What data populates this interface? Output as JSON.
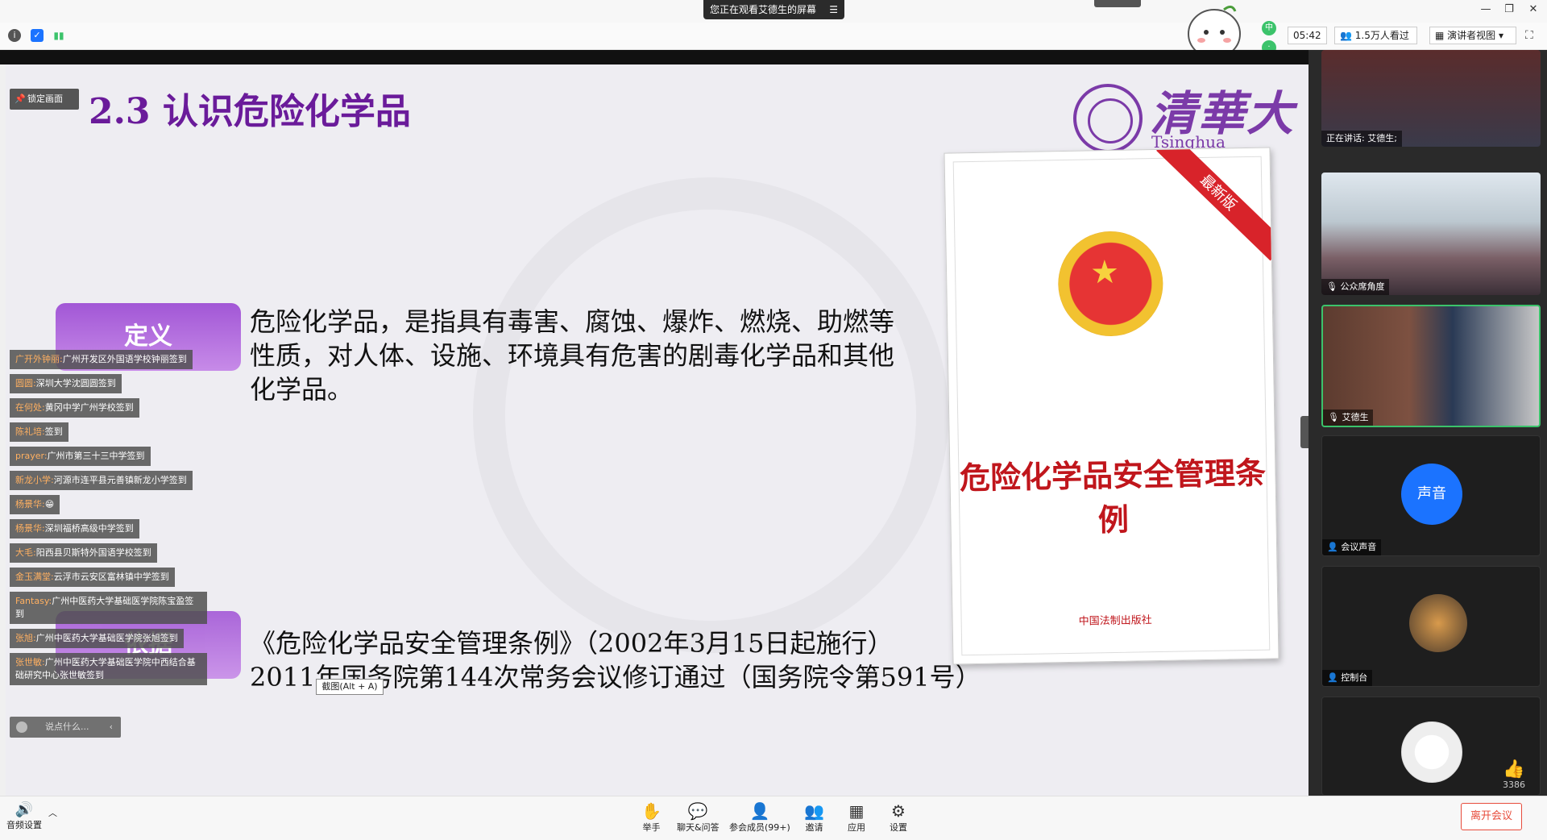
{
  "titlebar": {
    "share_notice": "您正在观看艾德生的屏幕",
    "share_menu": "☰"
  },
  "infobar": {
    "timer": "05:42",
    "viewers": "1.5万人看过",
    "view_mode": "演讲者视图",
    "mascot_dot_label": "中"
  },
  "slide": {
    "title": "2.3 认识危险化学品",
    "lock_label": "锁定画面",
    "logo_cn": "清華大學",
    "logo_en": "Tsinghua University",
    "definition_label": "定义",
    "definition_text": "危险化学品，是指具有毒害、腐蚀、爆炸、燃烧、助燃等性质，对人体、设施、环境具有危害的剧毒化学品和其他化学品。",
    "basis_label": "依据",
    "basis_line1": "《危险化学品安全管理条例》（2002年3月15日起施行）",
    "basis_line2": "2011年国务院第144次常务会议修订通过（国务院令第591号）",
    "book_ribbon": "最新版",
    "book_title": "危险化学品安全管理条例",
    "book_publisher": "中国法制出版社",
    "screenshot_tip": "截图(Alt + A)"
  },
  "chat": {
    "messages": [
      {
        "name": "广开外钟丽:",
        "text": "广州开发区外国语学校钟丽签到"
      },
      {
        "name": "圆圆:",
        "text": "深圳大学沈圆圆签到"
      },
      {
        "name": "在何处:",
        "text": "黄冈中学广州学校签到"
      },
      {
        "name": "陈礼培:",
        "text": "签到"
      },
      {
        "name": "prayer:",
        "text": "广州市第三十三中学签到"
      },
      {
        "name": "新龙小学:",
        "text": "河源市连平县元善镇新龙小学签到"
      },
      {
        "name": "杨景华:",
        "text": "😁"
      },
      {
        "name": "杨景华:",
        "text": "深圳福桥高级中学签到"
      },
      {
        "name": "大毛:",
        "text": "阳西县贝斯特外国语学校签到"
      },
      {
        "name": "金玉满堂:",
        "text": "云浮市云安区富林镇中学签到"
      },
      {
        "name": "Fantasy:",
        "text": "广州中医药大学基础医学院陈宝盈签到"
      },
      {
        "name": "张旭:",
        "text": "广州中医药大学基础医学院张旭签到"
      },
      {
        "name": "张世敏:",
        "text": "广州中医药大学基础医学院中西结合基础研究中心张世敏签到"
      }
    ],
    "input_placeholder": "说点什么...",
    "collapse_arrow": "‹"
  },
  "panel": {
    "speaking": "正在讲话: 艾德生;",
    "tile2_label": "公众席角度",
    "tile3_label": "艾德生",
    "tile4_circle": "声音",
    "tile4_label": "会议声音",
    "tile5_label": "控制台",
    "likes_count": "3386"
  },
  "toolbar": {
    "audio_settings": "音频设置",
    "raise_hand": "举手",
    "chat_qa": "聊天&问答",
    "participants": "参会成员(99+)",
    "invite": "邀请",
    "apps": "应用",
    "settings": "设置",
    "leave": "离开会议"
  }
}
